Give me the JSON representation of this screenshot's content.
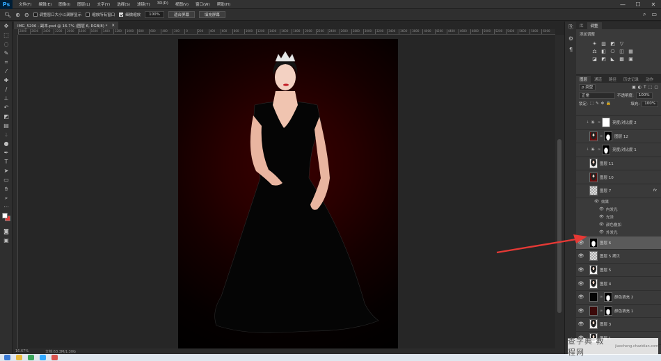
{
  "app": {
    "logo": "Ps"
  },
  "menu": [
    "文件(F)",
    "编辑(E)",
    "图像(I)",
    "图层(L)",
    "文字(Y)",
    "选择(S)",
    "滤镜(T)",
    "3D(D)",
    "视图(V)",
    "窗口(W)",
    "帮助(H)"
  ],
  "window_controls": {
    "minimize": "—",
    "maximize": "☐",
    "close": "✕"
  },
  "options": {
    "resize_windows": "调整窗口大小以满屏显示",
    "zoom_all": "缩放所有窗口",
    "scrubby_zoom": "细微缩放",
    "zoom_value": "100%",
    "fit_screen": "适合屏幕",
    "fill_screen": "填充屏幕"
  },
  "document": {
    "tab_title": "IMG_5206 - 副本.psd @ 16.7% (图层 6, RGB/8) *",
    "close": "✕"
  },
  "ruler_ticks": [
    "2800",
    "2600",
    "2400",
    "2200",
    "2000",
    "1800",
    "1600",
    "1400",
    "1200",
    "1000",
    "800",
    "600",
    "400",
    "200",
    "0",
    "200",
    "400",
    "600",
    "800",
    "1000",
    "1200",
    "1400",
    "1600",
    "1800",
    "2000",
    "2200",
    "2400",
    "2600",
    "2800",
    "3000",
    "3200",
    "3400",
    "3600",
    "3800",
    "4000",
    "4200",
    "4400",
    "4600",
    "4800",
    "5000",
    "5200",
    "5400",
    "5600",
    "5800",
    "6000"
  ],
  "status": {
    "zoom": "16.67%",
    "doc": "文档:63.3M/1.30G"
  },
  "colors": {
    "foreground": "#ffffff",
    "background": "#e53935",
    "arrow": "#e53935"
  },
  "adjustments": {
    "tabs": [
      "库",
      "调整"
    ],
    "subtitle": "添加调整",
    "icon_rows": [
      [
        "☀",
        "▥",
        "◩",
        "▽"
      ],
      [
        "⚖",
        "◧",
        "⎔",
        "◫",
        "▦"
      ],
      [
        "◪",
        "◩",
        "◣",
        "▩",
        "▣"
      ]
    ]
  },
  "layers_panel": {
    "tabs": [
      "图层",
      "通道",
      "路径",
      "历史记录",
      "动作"
    ],
    "filter_kind": "ρ 类型",
    "filter_icons": [
      "▣",
      "◐",
      "T",
      "⬚",
      "▢"
    ],
    "blend_mode": "正常",
    "opacity_label": "不透明度:",
    "opacity_value": "100%",
    "lock_label": "锁定:",
    "lock_icons": [
      "⬚",
      "✎",
      "✥",
      "🔒"
    ],
    "fill_label": "填充:",
    "fill_value": "100%",
    "layers": [
      {
        "name": "亮度/对比度 2",
        "kind": "adjust",
        "thumb": "white",
        "visible": false
      },
      {
        "name": "图层 12",
        "kind": "pixel",
        "thumb": "photo-red",
        "mask": true,
        "visible": false
      },
      {
        "name": "亮度/对比度 1",
        "kind": "adjust",
        "thumb": "mask",
        "visible": false
      },
      {
        "name": "图层 11",
        "kind": "pixel",
        "thumb": "photo",
        "visible": false
      },
      {
        "name": "图层 10",
        "kind": "pixel",
        "thumb": "photo-red",
        "visible": false
      },
      {
        "name": "图层 7",
        "kind": "pixel",
        "thumb": "checker",
        "visible": false,
        "fx": true
      },
      {
        "name": "图层 6",
        "kind": "pixel",
        "thumb": "mask",
        "visible": true,
        "selected": true
      },
      {
        "name": "图层 5 拷贝",
        "kind": "pixel",
        "thumb": "checker",
        "visible": true
      },
      {
        "name": "图层 5",
        "kind": "pixel",
        "thumb": "photo",
        "visible": true
      },
      {
        "name": "图层 4",
        "kind": "pixel",
        "thumb": "photo",
        "visible": true
      },
      {
        "name": "颜色填充 2",
        "kind": "fill",
        "thumb": "black",
        "mask": true,
        "visible": true
      },
      {
        "name": "颜色填充 1",
        "kind": "fill",
        "thumb": "darkred",
        "mask": true,
        "visible": true
      },
      {
        "name": "图层 3",
        "kind": "pixel",
        "thumb": "photo",
        "visible": true
      },
      {
        "name": "图层 1",
        "kind": "pixel",
        "thumb": "photo",
        "visible": true
      }
    ],
    "fx_mark": "fx",
    "effects_header": "效果",
    "effects": [
      "内发光",
      "光泽",
      "颜色叠加",
      "外发光"
    ]
  },
  "watermark": {
    "text": "查字典 教程网",
    "sub": "jiaocheng.chazidian.com"
  }
}
